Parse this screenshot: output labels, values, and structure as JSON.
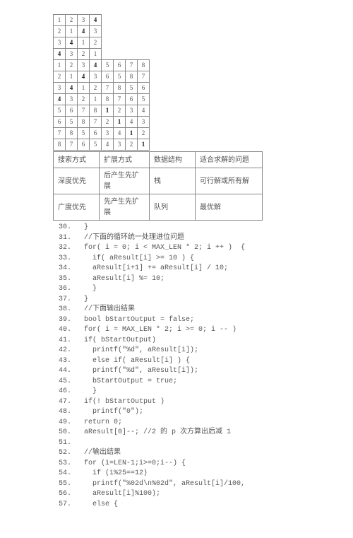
{
  "grid4a": [
    [
      1,
      2,
      3,
      4
    ],
    [
      2,
      1,
      4,
      3
    ],
    [
      3,
      4,
      1,
      2
    ],
    [
      4,
      3,
      2,
      1
    ]
  ],
  "grid4a_bold": [
    [
      0,
      0,
      0,
      1
    ],
    [
      0,
      0,
      1,
      0
    ],
    [
      0,
      1,
      0,
      0
    ],
    [
      1,
      0,
      0,
      0
    ]
  ],
  "grid8": [
    [
      1,
      2,
      3,
      4,
      5,
      6,
      7,
      8
    ],
    [
      2,
      1,
      4,
      3,
      6,
      5,
      8,
      7
    ],
    [
      3,
      4,
      1,
      2,
      7,
      8,
      5,
      6
    ],
    [
      4,
      3,
      2,
      1,
      8,
      7,
      6,
      5
    ],
    [
      5,
      6,
      7,
      8,
      1,
      2,
      3,
      4
    ],
    [
      6,
      5,
      8,
      7,
      2,
      1,
      4,
      3
    ],
    [
      7,
      8,
      5,
      6,
      3,
      4,
      1,
      2
    ],
    [
      8,
      7,
      6,
      5,
      4,
      3,
      2,
      1
    ]
  ],
  "grid8_bold": [
    [
      0,
      0,
      0,
      1,
      0,
      0,
      0,
      0
    ],
    [
      0,
      0,
      1,
      0,
      0,
      0,
      0,
      0
    ],
    [
      0,
      1,
      0,
      0,
      0,
      0,
      0,
      0
    ],
    [
      1,
      0,
      0,
      0,
      0,
      0,
      0,
      0
    ],
    [
      0,
      0,
      0,
      0,
      1,
      0,
      0,
      0
    ],
    [
      0,
      0,
      0,
      0,
      0,
      1,
      0,
      0
    ],
    [
      0,
      0,
      0,
      0,
      0,
      0,
      1,
      0
    ],
    [
      0,
      0,
      0,
      0,
      0,
      0,
      0,
      1
    ]
  ],
  "info_table": {
    "header": [
      "搜索方式",
      "扩展方式",
      "数据结构",
      "适合求解的问题"
    ],
    "rows": [
      [
        "深度优先",
        "后产生先扩展",
        "栈",
        "可行解或所有解"
      ],
      [
        "广度优先",
        "先产生先扩展",
        "队列",
        "最优解"
      ]
    ]
  },
  "code_lines": [
    {
      "n": 30,
      "t": "  }"
    },
    {
      "n": 31,
      "t": "  //下面的循环统一处理进位问题"
    },
    {
      "n": 32,
      "t": "  for( i = 0; i < MAX_LEN * 2; i ++ )  {"
    },
    {
      "n": 33,
      "t": "    if( aResult[i] >= 10 ) {"
    },
    {
      "n": 34,
      "t": "    aResult[i+1] += aResult[i] / 10;"
    },
    {
      "n": 35,
      "t": "    aResult[i] %= 10;"
    },
    {
      "n": 36,
      "t": "    }"
    },
    {
      "n": 37,
      "t": "  }"
    },
    {
      "n": 38,
      "t": "  //下面输出结果"
    },
    {
      "n": 39,
      "t": "  bool bStartOutput = false;"
    },
    {
      "n": 40,
      "t": "  for( i = MAX_LEN * 2; i >= 0; i -- )"
    },
    {
      "n": 41,
      "t": "  if( bStartOutput)"
    },
    {
      "n": 42,
      "t": "    printf(\"%d\", aResult[i]);"
    },
    {
      "n": 43,
      "t": "    else if( aResult[i] ) {"
    },
    {
      "n": 44,
      "t": "    printf(\"%d\", aResult[i]);"
    },
    {
      "n": 45,
      "t": "    bStartOutput = true;"
    },
    {
      "n": 46,
      "t": "    }"
    },
    {
      "n": 47,
      "t": "  if(! bStartOutput )"
    },
    {
      "n": 48,
      "t": "    printf(\"0\");"
    },
    {
      "n": 49,
      "t": "  return 0;"
    },
    {
      "n": 50,
      "t": "  aResult[0]--; //2 的 p 次方算出后减 1"
    },
    {
      "n": 51,
      "t": ""
    },
    {
      "n": 52,
      "t": "  //输出结果"
    },
    {
      "n": 53,
      "t": "  for (i=LEN-1;i>=0;i--) {"
    },
    {
      "n": 54,
      "t": "    if (i%25==12)"
    },
    {
      "n": 55,
      "t": "    printf(\"%02d\\n%02d\", aResult[i]/100,"
    },
    {
      "n": 56,
      "t": "    aResult[i]%100);"
    },
    {
      "n": 57,
      "t": "    else {"
    }
  ]
}
